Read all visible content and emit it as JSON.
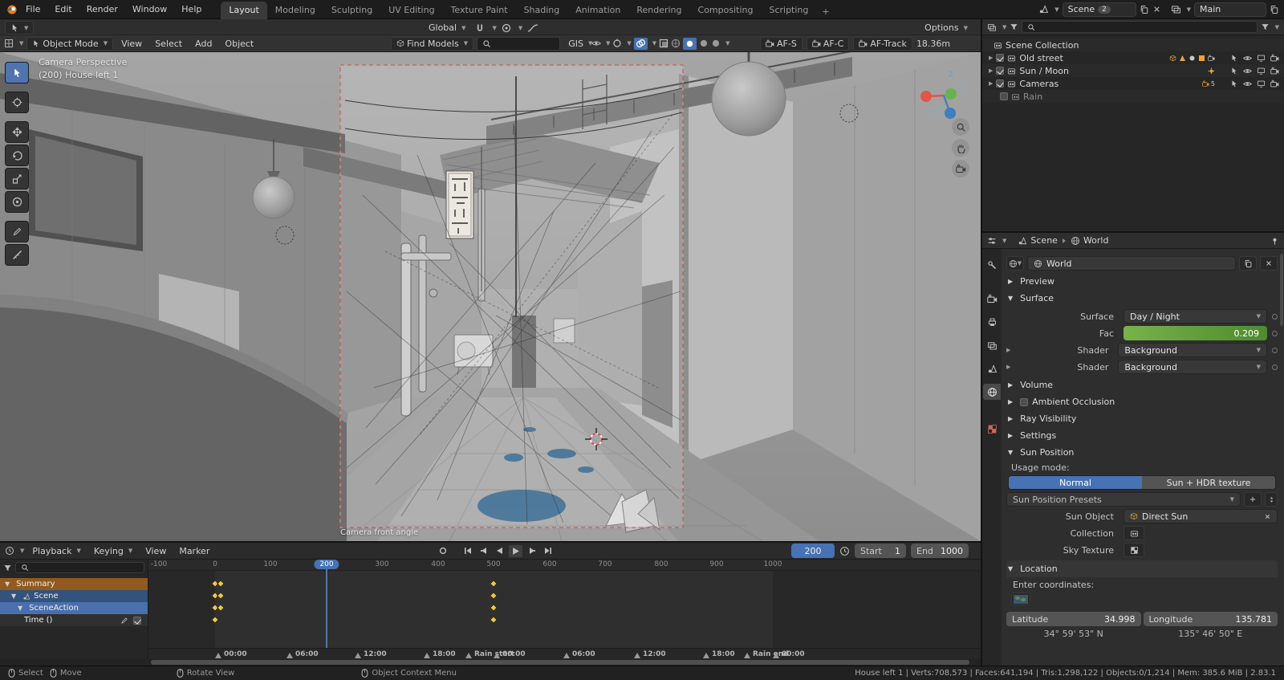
{
  "topbar": {
    "menus": [
      "File",
      "Edit",
      "Render",
      "Window",
      "Help"
    ],
    "workspaces": [
      "Layout",
      "Modeling",
      "Sculpting",
      "UV Editing",
      "Texture Paint",
      "Shading",
      "Animation",
      "Rendering",
      "Compositing",
      "Scripting"
    ],
    "new_workspace": "+",
    "scene": {
      "name": "Scene",
      "badge": "2"
    },
    "view_layer": {
      "name": "Main"
    }
  },
  "toolsettings": {
    "orientation": "Global",
    "options": "Options"
  },
  "viewport_header": {
    "mode": "Object Mode",
    "menus": [
      "View",
      "Select",
      "Add",
      "Object"
    ],
    "find_models": "Find Models",
    "gis": "GIS",
    "af_s": "AF-S",
    "af_c": "AF-C",
    "af_track": "AF-Track",
    "distance": "18.36m"
  },
  "viewport": {
    "overlay_line1": "Camera Perspective",
    "overlay_line2": "(200) House left 1",
    "camera_name": "Camera front angle",
    "gizmo_axis": "z"
  },
  "timeline": {
    "menus": [
      "Playback",
      "Keying",
      "View",
      "Marker"
    ],
    "frame": "200",
    "start_label": "Start",
    "start": "1",
    "end_label": "End",
    "end": "1000",
    "ruler": [
      "-100",
      "0",
      "100",
      "200",
      "300",
      "400",
      "500",
      "600",
      "700",
      "800",
      "900",
      "1000"
    ],
    "channels": [
      {
        "label": "Summary"
      },
      {
        "label": "Scene"
      },
      {
        "label": "SceneAction"
      },
      {
        "label": "Time ()"
      }
    ],
    "markers": [
      "00:00",
      "06:00",
      "12:00",
      "18:00",
      "Rain start",
      "00:00",
      "06:00",
      "12:00",
      "18:00",
      "Rain end",
      "00:00"
    ]
  },
  "outliner": {
    "root": "Scene Collection",
    "items": [
      {
        "label": "Old street"
      },
      {
        "label": "Sun / Moon"
      },
      {
        "label": "Cameras",
        "count": "5"
      },
      {
        "label": "Rain"
      }
    ]
  },
  "properties": {
    "breadcrumb": {
      "scene": "Scene",
      "world": "World"
    },
    "world_field": "World",
    "panels": {
      "preview": "Preview",
      "surface": "Surface",
      "volume": "Volume",
      "ambient_occlusion": "Ambient Occlusion",
      "ray_visibility": "Ray Visibility",
      "settings": "Settings",
      "sun_position": "Sun Position",
      "location": "Location"
    },
    "surface": {
      "surface_label": "Surface",
      "surface_value": "Day / Night",
      "fac_label": "Fac",
      "fac_value": "0.209",
      "shader_label": "Shader",
      "shader_value": "Background",
      "shader2_label": "Shader",
      "shader2_value": "Background"
    },
    "sun": {
      "usage_mode": "Usage mode:",
      "normal": "Normal",
      "hdr": "Sun + HDR texture",
      "presets": "Sun Position Presets",
      "sun_object_label": "Sun Object",
      "sun_object_value": "Direct Sun",
      "collection_label": "Collection",
      "sky_texture_label": "Sky Texture",
      "enter_coordinates": "Enter coordinates:",
      "latitude_label": "Latitude",
      "latitude_value": "34.998",
      "longitude_label": "Longitude",
      "longitude_value": "135.781",
      "lat_dms": "34° 59' 53\" N",
      "lon_dms": "135° 46' 50\" E"
    }
  },
  "statusbar": {
    "hints": [
      "Select",
      "Move",
      "Rotate View",
      "Object Context Menu"
    ],
    "stats": "House left 1 | Verts:708,573 | Faces:641,194 | Tris:1,298,122 | Objects:0/1,214 | Mem: 385.6 MiB | 2.83.1"
  }
}
